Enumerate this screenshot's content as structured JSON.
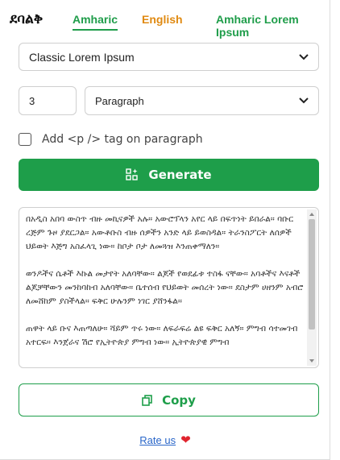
{
  "header": {
    "logo": "ደባልቅ",
    "tabs": [
      {
        "label": "Amharic",
        "active": true
      },
      {
        "label": "English",
        "active": false
      },
      {
        "label": "Amharic Lorem Ipsum",
        "active": false
      }
    ]
  },
  "form": {
    "style_select": {
      "value": "Classic Lorem Ipsum"
    },
    "count_input": {
      "value": "3"
    },
    "unit_select": {
      "value": "Paragraph"
    },
    "p_tag_checkbox": {
      "label": "Add <p /> tag on paragraph",
      "checked": false
    },
    "generate_label": "Generate"
  },
  "output": {
    "paragraphs": [
      "በአዲስ አበባ ውስጥ ብዙ መኪናዎች አሉ። አውሮፕላን አየር ላይ በፍጥነት ይበራል። ባቡር ረጅም ጉዞ ያደርጋል። አውቶቡስ ብዙ ሰዎችን አንድ ላይ ይወስዳል። ትራንስፖርት ለሰዎች ህይወት እጅግ አስፈላጊ ነው። ከቦታ ቦታ ለመጓዝ እንጠቀማለን።",
      "ወንዶችና ሴቶች እኩል መታየት አለባቸው። ልጆች የወደፊቱ ተስፋ ናቸው። አባቶችና እናቶች ልጆቻቸውን መንከባከብ አለባቸው። ቤተሰብ የህይወት መሰረት ነው። ደስታም ሀዘንም አብሮ ለመሸከም ያስችላል። ፍቅር ሁሉንም ነገር ያሸንፋል።",
      "ጠዋት ላይ ቡና እጠጣለሁ። ሻይም ጥሩ ነው። ለፍራፍሬ ልዩ ፍቅር አለኝ። ምግብ ሳተመገብ አተርፍ። እንጀራና ሽሮ የኢትዮጵያ ምግብ ነው። ኢትዮጵያዊ ምግብ"
    ]
  },
  "copy_label": "Copy",
  "footer": {
    "rate_label": "Rate us",
    "heart": "❤"
  },
  "colors": {
    "accent": "#1e9e4a",
    "english_tab": "#e08a12",
    "link": "#2a66c9",
    "heart": "#e0242e"
  },
  "icons": {
    "generate": "sparkle-grid-icon",
    "copy": "copy-icon",
    "dropdown": "chevron-down-icon"
  }
}
